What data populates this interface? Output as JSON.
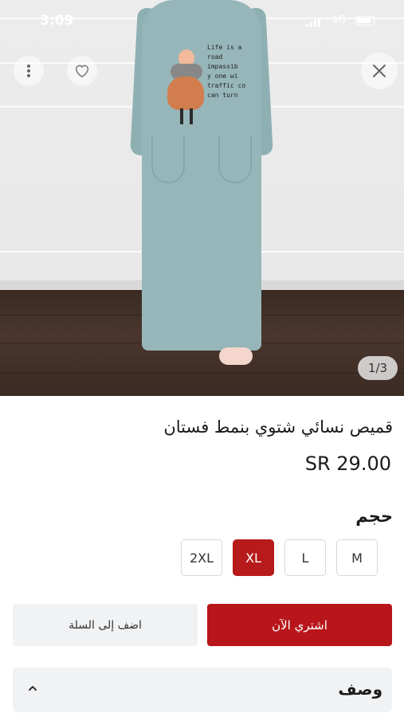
{
  "status_bar": {
    "time": "3:09",
    "network": "4G"
  },
  "gallery": {
    "page_indicator": "1/3",
    "print_text": "Life is a\nroad\nimpassib\ny one wi\ntraffic co\ncan turn"
  },
  "product": {
    "title": "قميص نسائي شتوي بنمط فستان",
    "price": "SR 29.00"
  },
  "size_section": {
    "label": "حجم",
    "options": [
      "2XL",
      "XL",
      "L",
      "M"
    ],
    "selected": "XL"
  },
  "actions": {
    "add_to_cart": "اضف إلى السلة",
    "buy_now": "اشتري الآن"
  },
  "description": {
    "label": "وصف"
  },
  "colors": {
    "accent": "#b8161b",
    "dress": "#97b6b9"
  }
}
